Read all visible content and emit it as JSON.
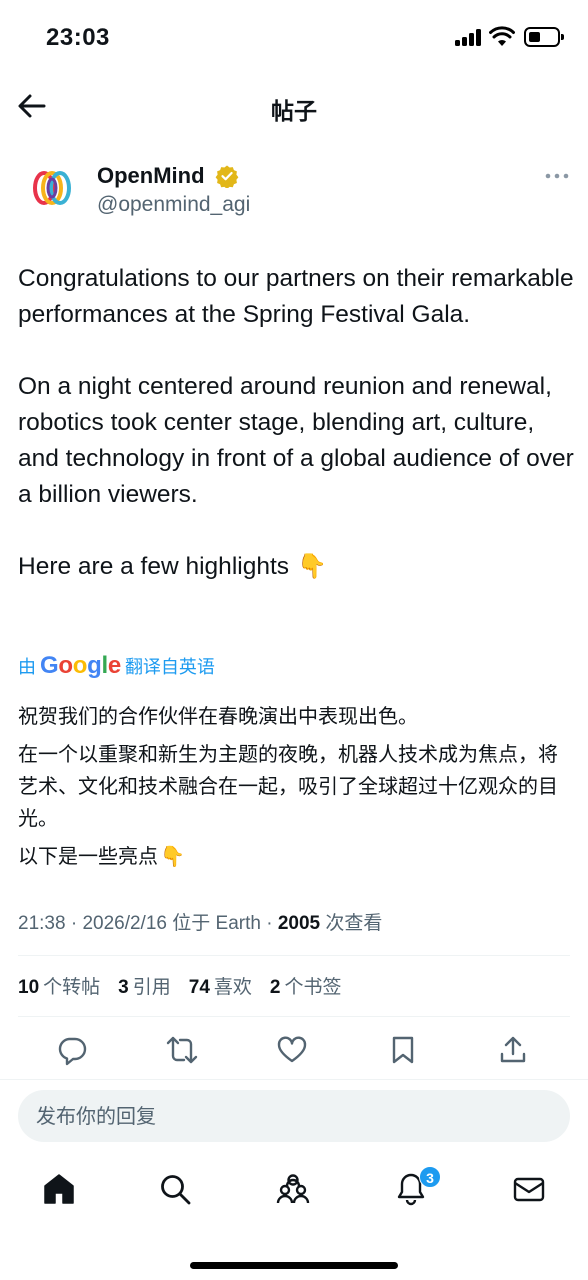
{
  "status_bar": {
    "time": "23:03"
  },
  "header": {
    "title": "帖子"
  },
  "author": {
    "name": "OpenMind",
    "handle": "@openmind_agi"
  },
  "tweet": {
    "paragraphs": [
      "Congratulations to our partners on their remarkable performances at the Spring Festival Gala.",
      "On a night centered around reunion and renewal, robotics took center stage, blending art, culture, and technology in front of a global audience of over a billion viewers.",
      "Here are a few highlights"
    ],
    "emoji": "👇"
  },
  "translation": {
    "prefix": "由",
    "brand": "Google",
    "suffix": "翻译自英语",
    "paragraphs": [
      "祝贺我们的合作伙伴在春晚演出中表现出色。",
      "在一个以重聚和新生为主题的夜晚，机器人技术成为焦点，将艺术、文化和技术融合在一起，吸引了全球超过十亿观众的目光。",
      "以下是一些亮点"
    ]
  },
  "meta": {
    "time": "21:38",
    "date": "2026/2/16",
    "location": "位于 Earth",
    "views": "2005",
    "views_label": "次查看"
  },
  "stats": [
    {
      "count": "10",
      "label": "个转帖"
    },
    {
      "count": "3",
      "label": "引用"
    },
    {
      "count": "74",
      "label": "喜欢"
    },
    {
      "count": "2",
      "label": "个书签"
    }
  ],
  "reply": {
    "placeholder": "发布你的回复"
  },
  "notifications": {
    "badge": "3"
  },
  "colors": {
    "accent": "#1d9bf0",
    "verified": "#e2b719",
    "muted": "#536471"
  }
}
